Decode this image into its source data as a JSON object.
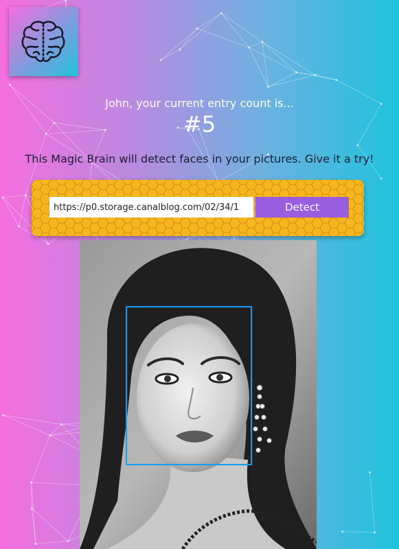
{
  "app": {
    "logo_icon": "brain-icon"
  },
  "rank": {
    "greeting": "John, your current entry count is...",
    "count": "#5"
  },
  "description": "This Magic Brain will detect faces in your pictures. Give it a try!",
  "form": {
    "url_value": "https://p0.storage.canalblog.com/02/34/1",
    "detect_label": "Detect"
  },
  "colors": {
    "gradient_left": "#f56ee0",
    "gradient_right": "#1ec3dc",
    "panel": "#f7b51e",
    "button": "#9b5de0",
    "face_box": "#149df2"
  },
  "result": {
    "faces_detected": 1
  }
}
